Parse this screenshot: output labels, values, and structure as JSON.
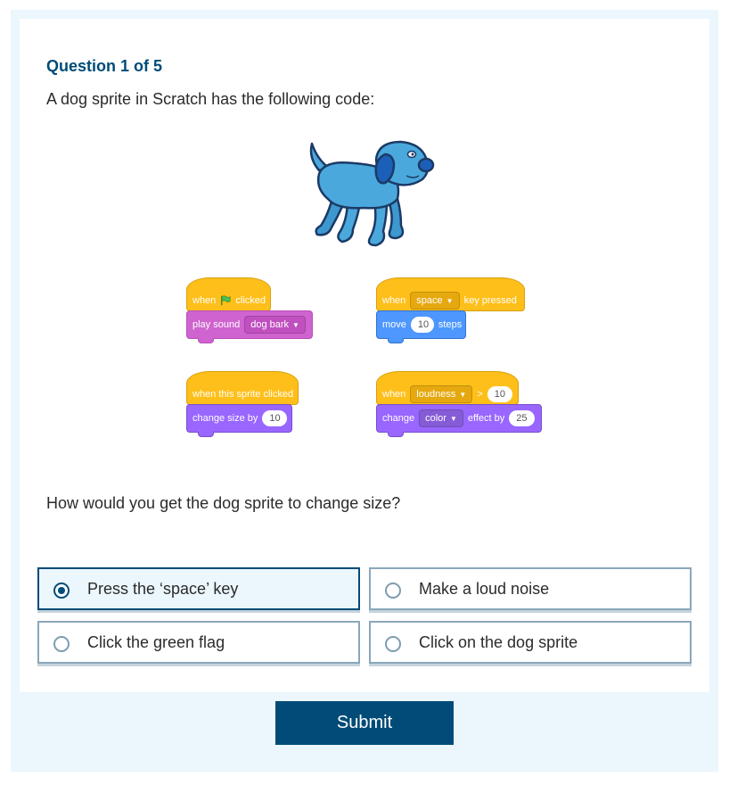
{
  "question": {
    "counter": "Question 1 of 5",
    "text": "A dog sprite in Scratch has the following code:",
    "prompt": "How would you get the dog sprite to change size?"
  },
  "blocks": {
    "script1": {
      "when": "when",
      "clicked": "clicked",
      "play_sound": "play sound",
      "sound": "dog bark"
    },
    "script2": {
      "when": "when",
      "key": "space",
      "key_pressed": "key pressed",
      "move": "move",
      "steps_value": "10",
      "steps": "steps"
    },
    "script3": {
      "hat": "when this sprite clicked",
      "change_size": "change size by",
      "size_value": "10"
    },
    "script4": {
      "when": "when",
      "sensor": "loudness",
      "gt": ">",
      "threshold": "10",
      "change": "change",
      "effect": "color",
      "effect_by": "effect by",
      "effect_value": "25"
    }
  },
  "options": [
    {
      "label": "Press the ‘space’ key",
      "selected": true
    },
    {
      "label": "Make a loud noise",
      "selected": false
    },
    {
      "label": "Click the green flag",
      "selected": false
    },
    {
      "label": "Click on the dog sprite",
      "selected": false
    }
  ],
  "submit_label": "Submit",
  "colors": {
    "primary": "#004b77",
    "background": "#ebf6fd",
    "events_block": "#ffbf1a",
    "sound_block": "#cf63cf",
    "motion_block": "#4d97ff",
    "looks_block": "#9966ff",
    "dog": "#4aa8dc"
  }
}
